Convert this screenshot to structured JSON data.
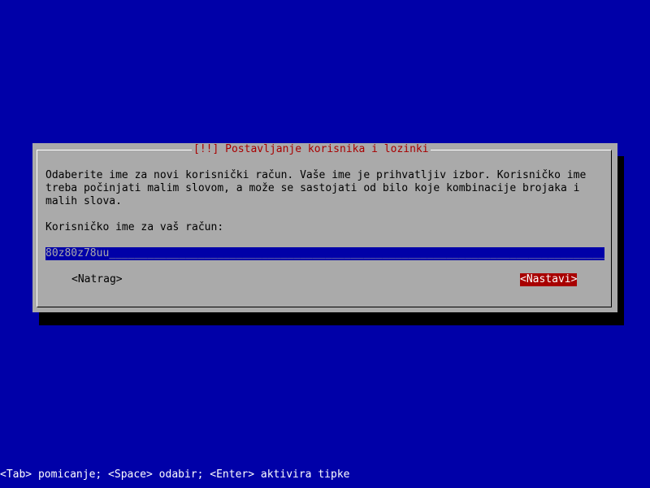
{
  "dialog": {
    "title": "[!!] Postavljanje korisnika i lozinki",
    "description_lines": [
      "Odaberite ime za novi korisnički račun. Vaše ime je prihvatljiv izbor. Korisničko ime",
      "treba počinjati malim slovom, a može se sastojati od bilo koje kombinacije brojaka i",
      "malih slova."
    ],
    "field_label": "Korisničko ime za vaš račun:",
    "field_value": "80z80z78uu",
    "back_button": "<Natrag>",
    "continue_button": "<Nastavi>"
  },
  "statusbar": {
    "text": "<Tab> pomicanje; <Space> odabir; <Enter> aktivira tipke"
  },
  "colors": {
    "background": "#0000a8",
    "dialog": "#aaaaaa",
    "title": "#a80000",
    "selected_button": "#a80000",
    "input_field": "#0000a8"
  }
}
